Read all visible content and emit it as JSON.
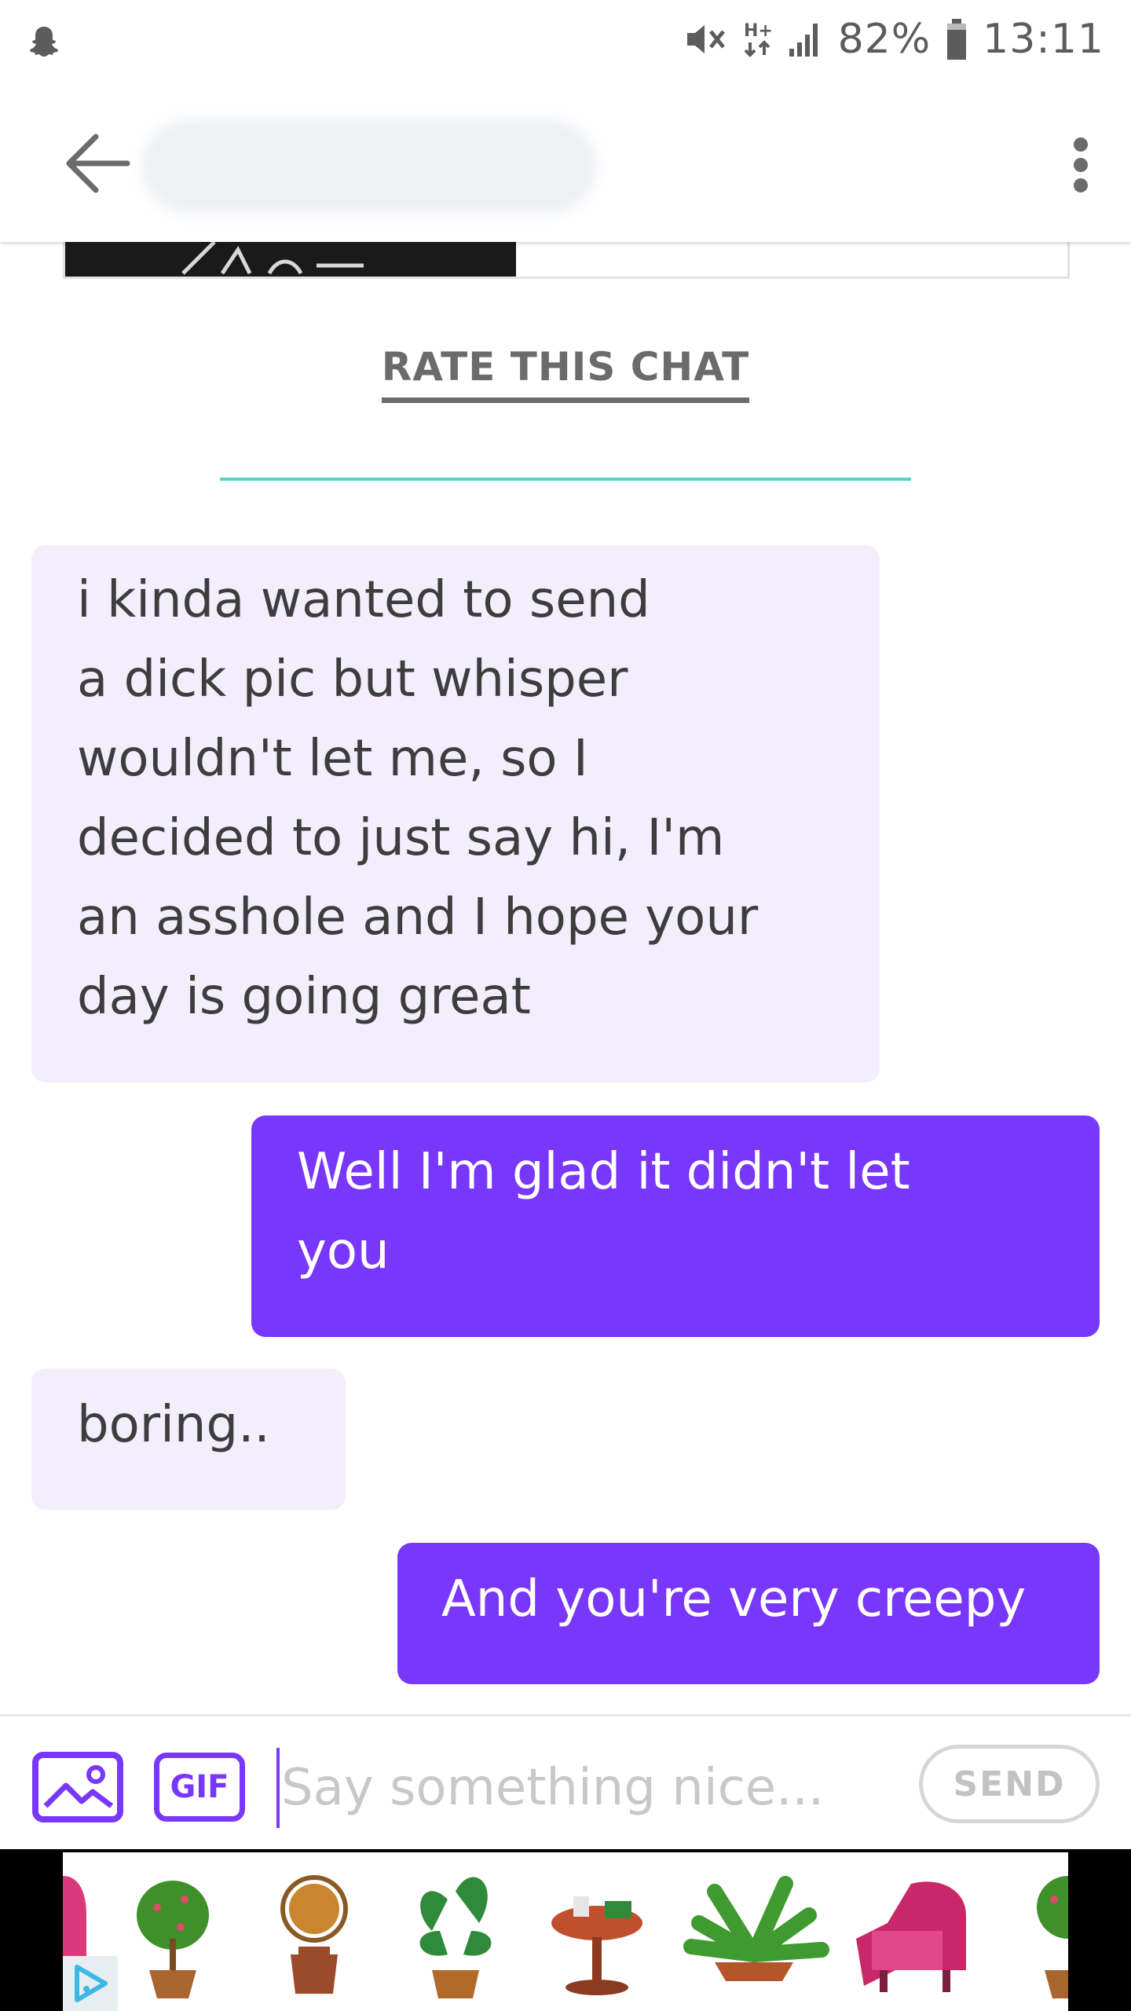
{
  "status_bar": {
    "battery_percent": "82%",
    "time": "13:11",
    "icons": [
      "snapchat-ghost-icon",
      "mute-icon",
      "hplus-icon",
      "signal-icon",
      "battery-icon"
    ]
  },
  "app_bar": {
    "back_icon": "arrow-left-icon",
    "menu_icon": "more-vertical-icon"
  },
  "chat": {
    "rate_link": "RATE THIS CHAT",
    "messages": [
      {
        "from": "them",
        "text": "i kinda wanted to send\na dick pic but whisper\nwouldn't let me, so I\ndecided to just say hi, I'm\nan asshole and I hope your\nday is going great"
      },
      {
        "from": "me",
        "text": "Well I'm glad it didn't let\nyou"
      },
      {
        "from": "them",
        "text": "boring.."
      },
      {
        "from": "me",
        "text": "And you're very creepy"
      }
    ]
  },
  "composer": {
    "image_icon": "image-icon",
    "gif_label": "GIF",
    "placeholder": "Say something nice...",
    "value": "",
    "send_label": "SEND"
  },
  "ad": {
    "choices_icon": "adchoices-icon"
  },
  "colors": {
    "accent": "#7837fb",
    "incoming_bubble": "#f2eefc",
    "divider": "#4fd6bd",
    "rate_link": "#6b6b6b"
  }
}
